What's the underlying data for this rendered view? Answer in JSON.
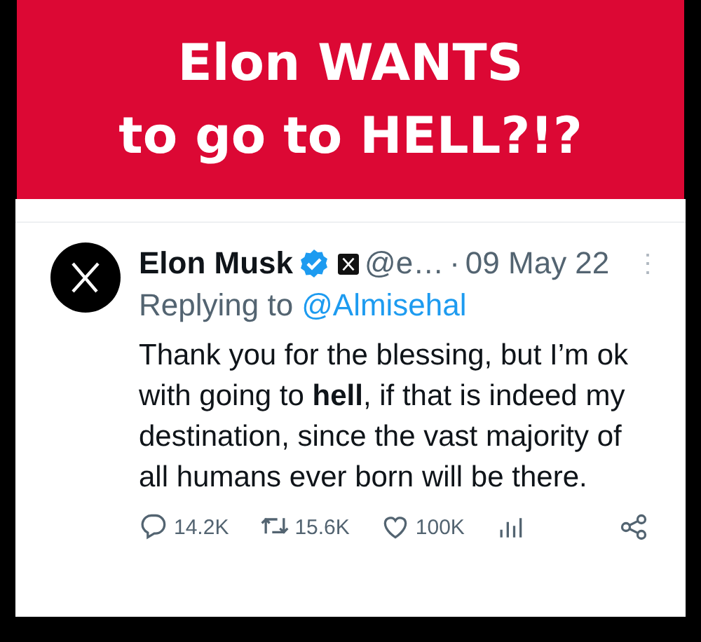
{
  "banner": {
    "title_lines": [
      "Elon WANTS",
      "to go to HELL?!?"
    ]
  },
  "tweet": {
    "name": "Elon Musk",
    "verified": true,
    "handle": "@e…",
    "separator": "·",
    "date": "09 May 22",
    "more": "⋮",
    "replying_prefix": "Replying to",
    "replying_to": "@Almisehal",
    "text": "Thank you for the blessing, but I’m ok with going to **hell**, if that is indeed my destination, since the vast majority of all humans ever born will be there.",
    "actions": [
      {
        "kind": "reply",
        "count": "14.2K"
      },
      {
        "kind": "repost",
        "count": "15.6K"
      },
      {
        "kind": "like",
        "count": "100K"
      },
      {
        "kind": "views"
      },
      {
        "kind": "share"
      }
    ]
  }
}
